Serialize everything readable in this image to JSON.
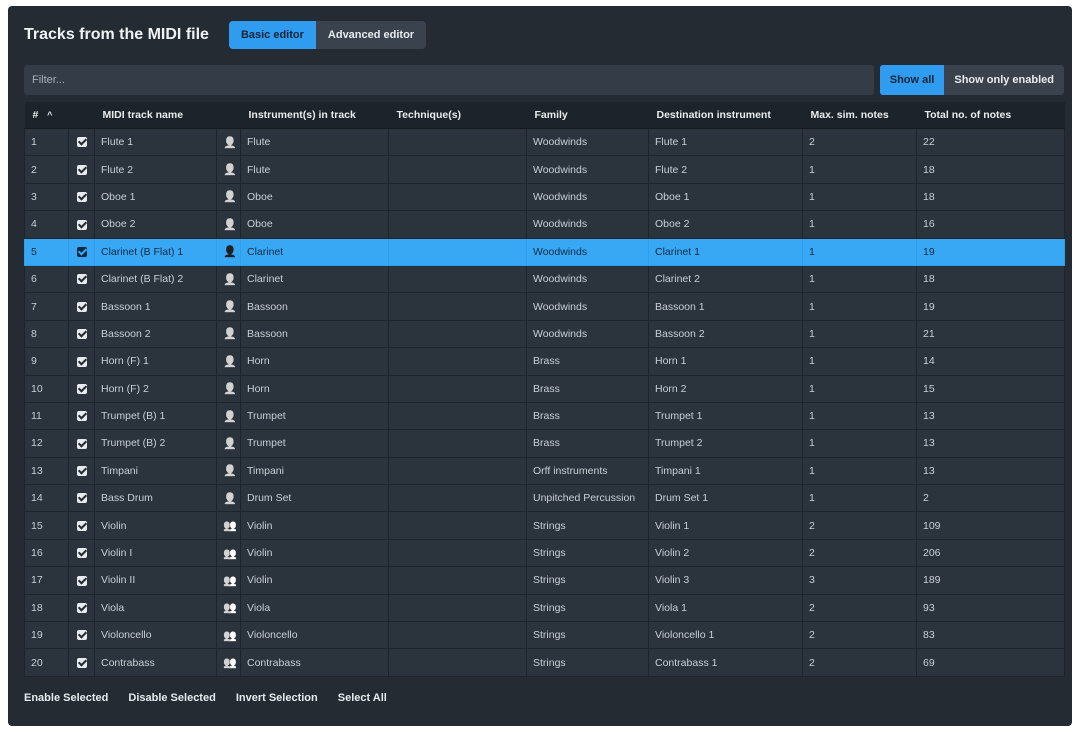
{
  "header": {
    "title": "Tracks from the MIDI file",
    "tabs": [
      "Basic editor",
      "Advanced editor"
    ]
  },
  "filter": {
    "placeholder": "Filter..."
  },
  "show_buttons": [
    "Show all",
    "Show only enabled"
  ],
  "columns": [
    "#",
    "MIDI track name",
    "Instrument(s) in track",
    "Technique(s)",
    "Family",
    "Destination instrument",
    "Max. sim. notes",
    "Total no. of notes"
  ],
  "rows": [
    {
      "num": "1",
      "name": "Flute 1",
      "icon": "single",
      "instrument": "Flute",
      "technique": "",
      "family": "Woodwinds",
      "dest": "Flute 1",
      "max": "2",
      "total": "22"
    },
    {
      "num": "2",
      "name": "Flute 2",
      "icon": "single",
      "instrument": "Flute",
      "technique": "",
      "family": "Woodwinds",
      "dest": "Flute 2",
      "max": "1",
      "total": "18"
    },
    {
      "num": "3",
      "name": "Oboe 1",
      "icon": "single",
      "instrument": "Oboe",
      "technique": "",
      "family": "Woodwinds",
      "dest": "Oboe 1",
      "max": "1",
      "total": "18"
    },
    {
      "num": "4",
      "name": "Oboe 2",
      "icon": "single",
      "instrument": "Oboe",
      "technique": "",
      "family": "Woodwinds",
      "dest": "Oboe 2",
      "max": "1",
      "total": "16"
    },
    {
      "num": "5",
      "name": "Clarinet (B Flat) 1",
      "icon": "single",
      "instrument": "Clarinet",
      "technique": "",
      "family": "Woodwinds",
      "dest": "Clarinet 1",
      "max": "1",
      "total": "19",
      "selected": true
    },
    {
      "num": "6",
      "name": "Clarinet (B Flat) 2",
      "icon": "single",
      "instrument": "Clarinet",
      "technique": "",
      "family": "Woodwinds",
      "dest": "Clarinet 2",
      "max": "1",
      "total": "18"
    },
    {
      "num": "7",
      "name": "Bassoon 1",
      "icon": "single",
      "instrument": "Bassoon",
      "technique": "",
      "family": "Woodwinds",
      "dest": "Bassoon 1",
      "max": "1",
      "total": "19"
    },
    {
      "num": "8",
      "name": "Bassoon 2",
      "icon": "single",
      "instrument": "Bassoon",
      "technique": "",
      "family": "Woodwinds",
      "dest": "Bassoon 2",
      "max": "1",
      "total": "21"
    },
    {
      "num": "9",
      "name": "Horn (F) 1",
      "icon": "single",
      "instrument": "Horn",
      "technique": "",
      "family": "Brass",
      "dest": "Horn 1",
      "max": "1",
      "total": "14"
    },
    {
      "num": "10",
      "name": "Horn (F) 2",
      "icon": "single",
      "instrument": "Horn",
      "technique": "",
      "family": "Brass",
      "dest": "Horn 2",
      "max": "1",
      "total": "15"
    },
    {
      "num": "11",
      "name": "Trumpet (B) 1",
      "icon": "single",
      "instrument": "Trumpet",
      "technique": "",
      "family": "Brass",
      "dest": "Trumpet 1",
      "max": "1",
      "total": "13"
    },
    {
      "num": "12",
      "name": "Trumpet (B) 2",
      "icon": "single",
      "instrument": "Trumpet",
      "technique": "",
      "family": "Brass",
      "dest": "Trumpet 2",
      "max": "1",
      "total": "13"
    },
    {
      "num": "13",
      "name": "Timpani",
      "icon": "single",
      "instrument": "Timpani",
      "technique": "",
      "family": "Orff instruments",
      "dest": "Timpani 1",
      "max": "1",
      "total": "13"
    },
    {
      "num": "14",
      "name": "Bass Drum",
      "icon": "single",
      "instrument": "Drum Set",
      "technique": "",
      "family": "Unpitched Percussion",
      "dest": "Drum Set 1",
      "max": "1",
      "total": "2"
    },
    {
      "num": "15",
      "name": "Violin",
      "icon": "group",
      "instrument": "Violin",
      "technique": "",
      "family": "Strings",
      "dest": "Violin 1",
      "max": "2",
      "total": "109"
    },
    {
      "num": "16",
      "name": "Violin I",
      "icon": "group",
      "instrument": "Violin",
      "technique": "",
      "family": "Strings",
      "dest": "Violin 2",
      "max": "2",
      "total": "206"
    },
    {
      "num": "17",
      "name": "Violin II",
      "icon": "group",
      "instrument": "Violin",
      "technique": "",
      "family": "Strings",
      "dest": "Violin 3",
      "max": "3",
      "total": "189"
    },
    {
      "num": "18",
      "name": "Viola",
      "icon": "group",
      "instrument": "Viola",
      "technique": "",
      "family": "Strings",
      "dest": "Viola 1",
      "max": "2",
      "total": "93"
    },
    {
      "num": "19",
      "name": "Violoncello",
      "icon": "group",
      "instrument": "Violoncello",
      "technique": "",
      "family": "Strings",
      "dest": "Violoncello 1",
      "max": "2",
      "total": "83"
    },
    {
      "num": "20",
      "name": "Contrabass",
      "icon": "group",
      "instrument": "Contrabass",
      "technique": "",
      "family": "Strings",
      "dest": "Contrabass 1",
      "max": "2",
      "total": "69"
    }
  ],
  "footer": [
    "Enable Selected",
    "Disable Selected",
    "Invert Selection",
    "Select All"
  ],
  "colors": {
    "accent": "#2f9cf0",
    "panel": "#242b33",
    "row": "#2b333c"
  },
  "sort_indicator": "^"
}
